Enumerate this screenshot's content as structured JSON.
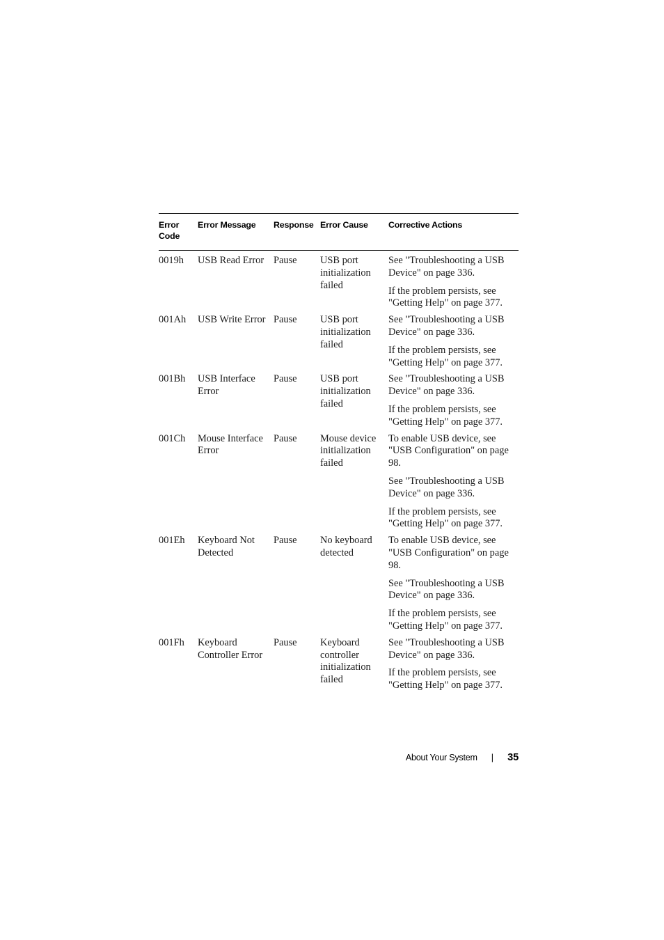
{
  "document": {
    "table": {
      "columns": [
        {
          "key": "error_code",
          "label": "Error Code"
        },
        {
          "key": "error_message",
          "label": "Error Message"
        },
        {
          "key": "response",
          "label": "Response"
        },
        {
          "key": "error_cause",
          "label": "Error Cause"
        },
        {
          "key": "corrective_actions",
          "label": "Corrective Actions"
        }
      ],
      "header": {
        "error_code": "Error Code",
        "error_message": "Error Message",
        "response": "Response",
        "error_cause": "Error Cause",
        "corrective_actions": "Corrective Actions"
      },
      "rows": [
        {
          "error_code": "0019h",
          "error_message": "USB Read Error",
          "response": "Pause",
          "error_cause": "USB port initialization failed",
          "corrective_actions": [
            "See \"Troubleshooting a USB Device\" on page 336.",
            "If the problem persists, see \"Getting Help\" on page 377."
          ]
        },
        {
          "error_code": "001Ah",
          "error_message": "USB Write Error",
          "response": "Pause",
          "error_cause": "USB port initialization failed",
          "corrective_actions": [
            "See \"Troubleshooting a USB Device\" on page 336.",
            "If the problem persists, see \"Getting Help\" on page 377."
          ]
        },
        {
          "error_code": "001Bh",
          "error_message": "USB Interface Error",
          "response": "Pause",
          "error_cause": "USB port initialization failed",
          "corrective_actions": [
            "See \"Troubleshooting a USB Device\" on page 336.",
            "If the problem persists, see \"Getting Help\" on page 377."
          ]
        },
        {
          "error_code": "001Ch",
          "error_message": "Mouse Interface Error",
          "response": "Pause",
          "error_cause": "Mouse device initialization failed",
          "corrective_actions": [
            "To enable USB device, see \"USB Configuration\" on page 98.",
            "See \"Troubleshooting a USB Device\" on page 336.",
            "If the problem persists, see \"Getting Help\" on page 377."
          ]
        },
        {
          "error_code": "001Eh",
          "error_message": "Keyboard Not Detected",
          "response": "Pause",
          "error_cause": "No keyboard detected",
          "corrective_actions": [
            "To enable USB device, see \"USB Configuration\" on page 98.",
            "See \"Troubleshooting a USB Device\" on page 336.",
            "If the problem persists, see \"Getting Help\" on page 377."
          ]
        },
        {
          "error_code": "001Fh",
          "error_message": "Keyboard Controller Error",
          "response": "Pause",
          "error_cause": "Keyboard controller initialization failed",
          "corrective_actions": [
            "See \"Troubleshooting a USB Device\" on page 336.",
            "If the problem persists, see \"Getting Help\" on page 377."
          ]
        }
      ]
    },
    "footer": {
      "section": "About Your System",
      "separator": "|",
      "page_number": "35"
    }
  }
}
